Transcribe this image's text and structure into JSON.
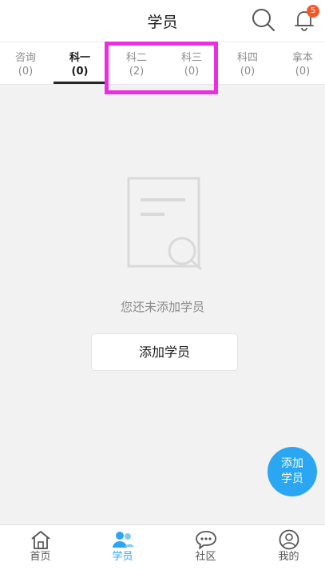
{
  "header": {
    "title": "学员",
    "badge_count": "5",
    "icons": {
      "search": "search-icon",
      "notification": "bell-icon"
    }
  },
  "tabs": [
    {
      "label": "咨询",
      "count": "(0)"
    },
    {
      "label": "科一",
      "count": "(0)",
      "active": true
    },
    {
      "label": "科二",
      "count": "(2)"
    },
    {
      "label": "科三",
      "count": "(0)"
    },
    {
      "label": "科四",
      "count": "(0)"
    },
    {
      "label": "拿本",
      "count": "(0)"
    }
  ],
  "empty_state": {
    "message": "您还未添加学员",
    "add_button": "添加学员",
    "icon": "empty-document-search-icon"
  },
  "fab": {
    "line1": "添加",
    "line2": "学员"
  },
  "bottom_nav": [
    {
      "label": "首页",
      "icon": "home-icon"
    },
    {
      "label": "学员",
      "icon": "students-icon",
      "active": true
    },
    {
      "label": "社区",
      "icon": "chat-icon"
    },
    {
      "label": "我的",
      "icon": "profile-icon"
    }
  ],
  "colors": {
    "accent": "#2ba6f2",
    "badge": "#f05a28",
    "highlight": "#ea2ee0",
    "background": "#f2f2f2"
  }
}
